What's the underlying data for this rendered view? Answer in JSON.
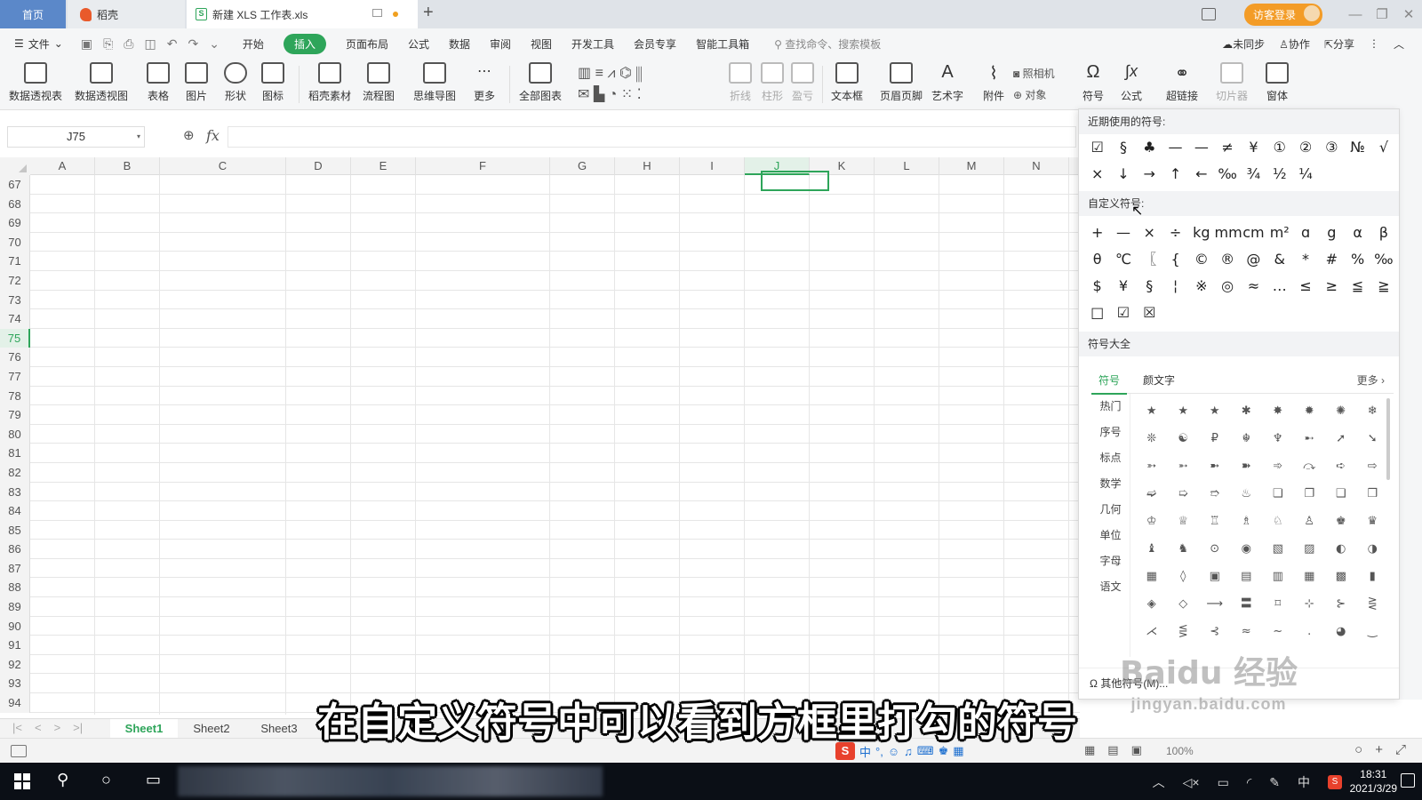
{
  "tabs": {
    "home": "首页",
    "wps": "稻壳",
    "file": "新建 XLS 工作表.xls"
  },
  "window": {
    "login": "访客登录"
  },
  "menu": {
    "file": "文件",
    "items": [
      "开始",
      "插入",
      "页面布局",
      "公式",
      "数据",
      "审阅",
      "视图",
      "开发工具",
      "会员专享",
      "智能工具箱"
    ],
    "search_placeholder": "查找命令、搜索模板",
    "unsynced": "未同步",
    "collab": "协作",
    "share": "分享"
  },
  "ribbon": {
    "pivot_table": "数据透视表",
    "pivot_chart": "数据透视图",
    "table": "表格",
    "picture": "图片",
    "shape": "形状",
    "icon": "图标",
    "docer_material": "稻壳素材",
    "flowchart": "流程图",
    "mindmap": "思维导图",
    "more": "更多",
    "all_charts": "全部图表",
    "line": "折线",
    "column": "柱形",
    "winloss": "盈亏",
    "textbox": "文本框",
    "header_footer": "页眉页脚",
    "wordart": "艺术字",
    "attachment": "附件",
    "camera": "照相机",
    "object": "对象",
    "symbol": "符号",
    "formula": "公式",
    "hyperlink": "超链接",
    "slicer": "切片器",
    "form": "窗体"
  },
  "formula_bar": {
    "namebox": "J75",
    "fx": "fx"
  },
  "grid": {
    "columns": [
      "A",
      "B",
      "C",
      "D",
      "E",
      "F",
      "G",
      "H",
      "I",
      "J",
      "K",
      "L",
      "M",
      "N"
    ],
    "rows": [
      "67",
      "68",
      "69",
      "70",
      "71",
      "72",
      "73",
      "74",
      "75",
      "76",
      "77",
      "78",
      "79",
      "80",
      "81",
      "82",
      "83",
      "84",
      "85",
      "86",
      "87",
      "88",
      "89",
      "90",
      "91",
      "92",
      "93",
      "94"
    ],
    "selected_column": "J",
    "selected_row": "75"
  },
  "sheets": [
    "Sheet1",
    "Sheet2",
    "Sheet3"
  ],
  "active_sheet": "Sheet1",
  "symbol_panel": {
    "recent_title": "近期使用的符号:",
    "recent": [
      "☑",
      "§",
      "♣",
      "—",
      "—",
      "≠",
      "¥",
      "①",
      "②",
      "③",
      "№",
      "√",
      "×",
      "↓",
      "→",
      "↑",
      "←",
      "‰",
      "¾",
      "½",
      "¼"
    ],
    "custom_title": "自定义符号:",
    "custom": [
      "+",
      "—",
      "×",
      "÷",
      "kg",
      "mm",
      "cm",
      "m²",
      "ɑ",
      "g",
      "α",
      "β",
      "θ",
      "℃",
      "〖",
      "{",
      "©",
      "®",
      "@",
      "&",
      "*",
      "#",
      "%",
      "‰",
      "$",
      "¥",
      "§",
      "¦",
      "※",
      "◎",
      "≈",
      "…",
      "≤",
      "≥",
      "≦",
      "≧",
      "□",
      "☑",
      "☒"
    ],
    "all_title": "符号大全",
    "tabs": [
      "符号",
      "颜文字"
    ],
    "more": "更多",
    "categories": [
      "热门",
      "序号",
      "标点",
      "数学",
      "几何",
      "单位",
      "字母",
      "语文"
    ],
    "grid": [
      "★",
      "★",
      "★",
      "✱",
      "✸",
      "✹",
      "✺",
      "❄",
      "❊",
      "☯",
      "₽",
      "☬",
      "♆",
      "➸",
      "➚",
      "➘",
      "➳",
      "➵",
      "➼",
      "➽",
      "➾",
      "⤼",
      "➪",
      "⇨",
      "➫",
      "➯",
      "➱",
      "♨",
      "❏",
      "❐",
      "❑",
      "❒",
      "♔",
      "♕",
      "♖",
      "♗",
      "♘",
      "♙",
      "♚",
      "♛",
      "♝",
      "♞",
      "⊙",
      "◉",
      "▧",
      "▨",
      "◐",
      "◑",
      "▦",
      "◊",
      "▣",
      "▤",
      "▥",
      "▦",
      "▩",
      "▮",
      "◈",
      "◇",
      "⟶",
      "〓",
      "⌑",
      "⊹",
      "⊱",
      "⋛",
      "⋌",
      "⋚",
      "⊰",
      "≈",
      "~",
      ".",
      "◕",
      "‿"
    ],
    "footer": "其他符号(M)..."
  },
  "subtitle": "在自定义符号中可以看到方框里打勾的符号",
  "watermark": {
    "logo": "Baidu 经验",
    "url": "jingyan.baidu.com"
  },
  "status": {
    "zoom": "100%"
  },
  "taskbar": {
    "time": "18:31",
    "date": "2021/3/29",
    "ime": "中"
  }
}
